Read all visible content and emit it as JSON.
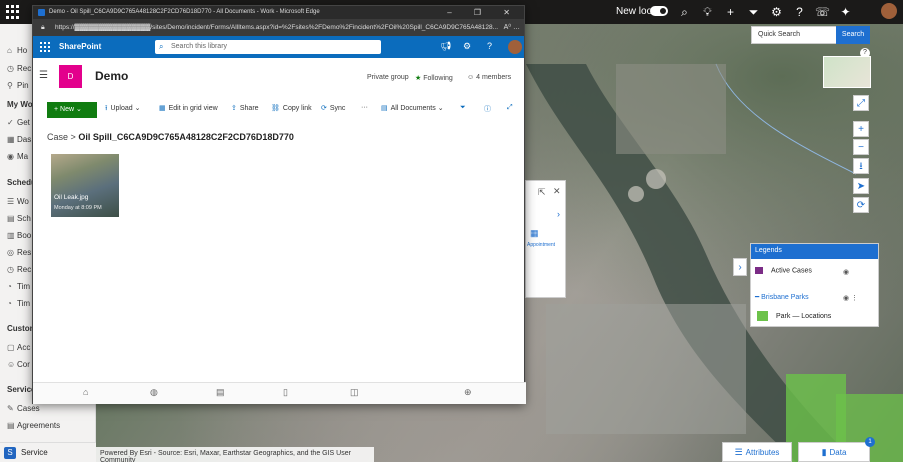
{
  "topbar": {
    "new_look_label": "New look",
    "icons": [
      "search-icon",
      "lightbulb-icon",
      "plus-icon",
      "filter-icon",
      "settings-icon",
      "help-icon",
      "chat-icon",
      "copilot-icon"
    ]
  },
  "leftnav": {
    "items": [
      {
        "label": "Ho",
        "icon": "⌂"
      },
      {
        "label": "Rec",
        "icon": "◷"
      },
      {
        "label": "Pin",
        "icon": "⚲"
      }
    ],
    "section_my_work": "My Wor",
    "items_my_work": [
      {
        "label": "Get",
        "icon": "✓"
      },
      {
        "label": "Das",
        "icon": "▦"
      },
      {
        "label": "Ma",
        "icon": "◉"
      }
    ],
    "section_schedule": "Schedul",
    "items_schedule": [
      {
        "label": "Wo",
        "icon": "☰"
      },
      {
        "label": "Sch",
        "icon": "▤"
      },
      {
        "label": "Boo",
        "icon": "▥"
      },
      {
        "label": "Res",
        "icon": "◎"
      },
      {
        "label": "Rec",
        "icon": "◷"
      },
      {
        "label": "Tim",
        "icon": "◔"
      },
      {
        "label": "Tim",
        "icon": "◔"
      }
    ],
    "section_customer": "Custome",
    "items_customer": [
      {
        "label": "Acc",
        "icon": "▢"
      },
      {
        "label": "Cor",
        "icon": "☺"
      }
    ],
    "section_service": "Service",
    "items_service": [
      {
        "label": "Cases",
        "icon": "✎"
      },
      {
        "label": "Agreements",
        "icon": "▤"
      }
    ],
    "area_switcher": {
      "letter": "S",
      "label": "Service"
    }
  },
  "map": {
    "quick_search_placeholder": "Quick Search",
    "search_button": "Search",
    "help_glyph": "?",
    "controls": [
      "⤢",
      "+",
      "−",
      "⭳",
      "➤",
      "⟳"
    ],
    "attribution": "Powered By Esri - Source: Esri, Maxar, Earthstar Geographics, and the GIS User Community",
    "attributes_tab": "Attributes",
    "data_tab": "Data",
    "data_badge": "1",
    "legends": {
      "title": "Legends",
      "rows": [
        {
          "label": "Active Cases",
          "color": "#7b2c86"
        },
        {
          "label": "Brisbane Parks",
          "color": "#1e6fd0"
        },
        {
          "label": "Park — Locations",
          "color": "#6cc24a"
        }
      ]
    },
    "side_panel_label": "Appointment"
  },
  "browser": {
    "window_title": "Demo - Oil Spill_C6CA9D9C765A48128C2F2CD76D18D770 - All Documents - Work - Microsoft Edge",
    "url": "https://▓▓▓▓▓▓▓▓▓▓▓▓▓▓▓▓/sites/Demo/incident/Forms/AllItems.aspx?id=%2Fsites%2FDemo%2Fincident%2FOil%20Spill_C6CA9D9C765A48128...",
    "url_suffix": "A⁰ …",
    "window_controls": "– ❐ ✕"
  },
  "sharepoint": {
    "brand": "SharePoint",
    "search_placeholder": "Search this library",
    "site_logo_letter": "D",
    "site_name": "Demo",
    "privacy": "Private group",
    "following": "Following",
    "members": "4 members",
    "commands": {
      "new": "New",
      "upload": "Upload",
      "edit_grid": "Edit in grid view",
      "share": "Share",
      "copy_link": "Copy link",
      "sync": "Sync",
      "more": "···",
      "view": "All Documents"
    },
    "breadcrumb": {
      "parent": "Case",
      "separator": ">",
      "current": "Oil Spill_C6CA9D9C765A48128C2F2CD76D18D770"
    },
    "files": [
      {
        "name": "Oil Leak.jpg",
        "modified": "Monday at 8:09 PM"
      }
    ]
  }
}
